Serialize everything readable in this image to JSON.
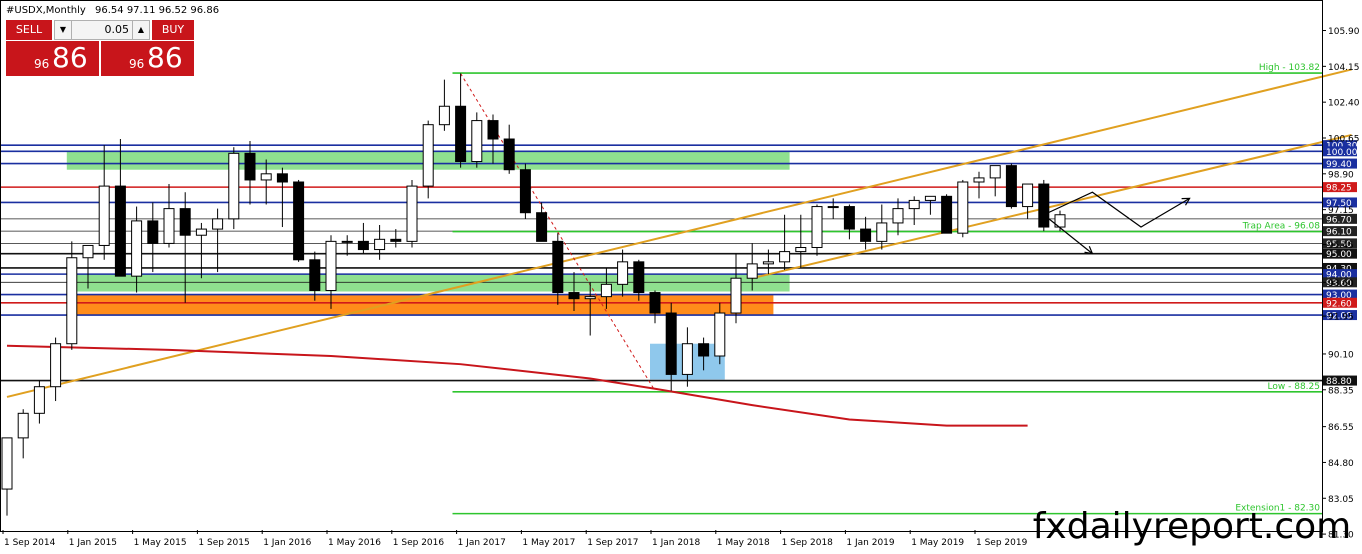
{
  "window": {
    "symbol": "#USDX,Monthly",
    "ohlc": "96.54 97.11 96.52 96.86"
  },
  "trade_panel": {
    "sell_label": "SELL",
    "buy_label": "BUY",
    "lot_value": "0.05",
    "sell_price_small": "96",
    "sell_price_big": "86",
    "buy_price_small": "96",
    "buy_price_big": "86"
  },
  "watermark": "fxdailyreport.com",
  "chart_data": {
    "type": "candlestick",
    "timeframe": "Monthly",
    "y_range": [
      81.5,
      107.0
    ],
    "y_ticks": [
      "105.90",
      "104.15",
      "102.40",
      "100.65",
      "98.90",
      "97.15",
      "95.45",
      "93.60",
      "91.95",
      "90.10",
      "88.35",
      "86.55",
      "84.80",
      "83.05",
      "81.30"
    ],
    "x_ticks": [
      "1 Sep 2014",
      "1 Jan 2015",
      "1 May 2015",
      "1 Sep 2015",
      "1 Jan 2016",
      "1 May 2016",
      "1 Sep 2016",
      "1 Jan 2017",
      "1 May 2017",
      "1 Sep 2017",
      "1 Jan 2018",
      "1 May 2018",
      "1 Sep 2018",
      "1 Jan 2019",
      "1 May 2019",
      "1 Sep 2019"
    ],
    "x_tick_index": [
      0,
      4,
      8,
      12,
      16,
      20,
      24,
      28,
      32,
      36,
      40,
      44,
      48,
      52,
      56,
      60
    ],
    "candles": [
      {
        "o": 83.5,
        "h": 86.0,
        "l": 82.2,
        "c": 86.0
      },
      {
        "o": 86.0,
        "h": 87.4,
        "l": 85.0,
        "c": 87.2
      },
      {
        "o": 87.2,
        "h": 88.8,
        "l": 86.7,
        "c": 88.5
      },
      {
        "o": 88.5,
        "h": 90.9,
        "l": 87.8,
        "c": 90.6
      },
      {
        "o": 90.6,
        "h": 95.6,
        "l": 90.3,
        "c": 94.8
      },
      {
        "o": 94.8,
        "h": 95.0,
        "l": 93.3,
        "c": 95.4
      },
      {
        "o": 95.4,
        "h": 100.3,
        "l": 94.7,
        "c": 98.3
      },
      {
        "o": 98.3,
        "h": 100.6,
        "l": 94.9,
        "c": 93.9
      },
      {
        "o": 93.9,
        "h": 97.3,
        "l": 93.1,
        "c": 96.6
      },
      {
        "o": 96.6,
        "h": 97.5,
        "l": 94.1,
        "c": 95.5
      },
      {
        "o": 95.5,
        "h": 98.4,
        "l": 95.3,
        "c": 97.2
      },
      {
        "o": 97.2,
        "h": 98.0,
        "l": 92.6,
        "c": 95.9
      },
      {
        "o": 95.9,
        "h": 96.5,
        "l": 93.8,
        "c": 96.2
      },
      {
        "o": 96.2,
        "h": 97.2,
        "l": 94.1,
        "c": 96.7
      },
      {
        "o": 96.7,
        "h": 100.2,
        "l": 96.2,
        "c": 99.9
      },
      {
        "o": 99.9,
        "h": 100.5,
        "l": 97.4,
        "c": 98.6
      },
      {
        "o": 98.6,
        "h": 99.6,
        "l": 97.4,
        "c": 98.9
      },
      {
        "o": 98.9,
        "h": 99.2,
        "l": 96.3,
        "c": 98.5
      },
      {
        "o": 98.5,
        "h": 98.6,
        "l": 94.6,
        "c": 94.7
      },
      {
        "o": 94.7,
        "h": 95.1,
        "l": 92.7,
        "c": 93.2
      },
      {
        "o": 93.2,
        "h": 95.9,
        "l": 92.3,
        "c": 95.6
      },
      {
        "o": 95.6,
        "h": 95.9,
        "l": 94.9,
        "c": 95.6
      },
      {
        "o": 95.6,
        "h": 96.5,
        "l": 95.0,
        "c": 95.2
      },
      {
        "o": 95.2,
        "h": 96.4,
        "l": 94.7,
        "c": 95.7
      },
      {
        "o": 95.7,
        "h": 96.2,
        "l": 95.3,
        "c": 95.6
      },
      {
        "o": 95.6,
        "h": 98.6,
        "l": 95.3,
        "c": 98.3
      },
      {
        "o": 98.3,
        "h": 101.5,
        "l": 97.7,
        "c": 101.3
      },
      {
        "o": 101.3,
        "h": 103.5,
        "l": 101.0,
        "c": 102.2
      },
      {
        "o": 102.2,
        "h": 103.8,
        "l": 99.2,
        "c": 99.5
      },
      {
        "o": 99.5,
        "h": 101.9,
        "l": 99.2,
        "c": 101.5
      },
      {
        "o": 101.5,
        "h": 101.8,
        "l": 99.4,
        "c": 100.6
      },
      {
        "o": 100.6,
        "h": 101.3,
        "l": 98.9,
        "c": 99.1
      },
      {
        "o": 99.1,
        "h": 99.4,
        "l": 96.7,
        "c": 97.0
      },
      {
        "o": 97.0,
        "h": 97.5,
        "l": 95.7,
        "c": 95.6
      },
      {
        "o": 95.6,
        "h": 96.0,
        "l": 92.5,
        "c": 93.1
      },
      {
        "o": 93.1,
        "h": 94.1,
        "l": 92.2,
        "c": 92.8
      },
      {
        "o": 92.8,
        "h": 93.6,
        "l": 91.0,
        "c": 92.9
      },
      {
        "o": 92.9,
        "h": 94.3,
        "l": 92.3,
        "c": 93.5
      },
      {
        "o": 93.5,
        "h": 95.2,
        "l": 92.9,
        "c": 94.6
      },
      {
        "o": 94.6,
        "h": 94.7,
        "l": 92.7,
        "c": 93.1
      },
      {
        "o": 93.1,
        "h": 93.2,
        "l": 91.6,
        "c": 92.1
      },
      {
        "o": 92.1,
        "h": 92.6,
        "l": 88.3,
        "c": 89.1
      },
      {
        "o": 89.1,
        "h": 91.4,
        "l": 88.5,
        "c": 90.6
      },
      {
        "o": 90.6,
        "h": 90.9,
        "l": 89.3,
        "c": 90.0
      },
      {
        "o": 90.0,
        "h": 92.6,
        "l": 89.6,
        "c": 92.1
      },
      {
        "o": 92.1,
        "h": 95.0,
        "l": 91.6,
        "c": 93.8
      },
      {
        "o": 93.8,
        "h": 95.5,
        "l": 93.2,
        "c": 94.5
      },
      {
        "o": 94.5,
        "h": 95.2,
        "l": 94.0,
        "c": 94.6
      },
      {
        "o": 94.6,
        "h": 96.9,
        "l": 94.2,
        "c": 95.1
      },
      {
        "o": 95.1,
        "h": 96.9,
        "l": 94.3,
        "c": 95.3
      },
      {
        "o": 95.3,
        "h": 97.4,
        "l": 94.9,
        "c": 97.3
      },
      {
        "o": 97.3,
        "h": 97.7,
        "l": 96.7,
        "c": 97.3
      },
      {
        "o": 97.3,
        "h": 97.4,
        "l": 95.7,
        "c": 96.2
      },
      {
        "o": 96.2,
        "h": 96.8,
        "l": 95.2,
        "c": 95.6
      },
      {
        "o": 95.6,
        "h": 97.4,
        "l": 95.2,
        "c": 96.5
      },
      {
        "o": 96.5,
        "h": 97.7,
        "l": 95.9,
        "c": 97.2
      },
      {
        "o": 97.2,
        "h": 97.8,
        "l": 96.4,
        "c": 97.6
      },
      {
        "o": 97.6,
        "h": 97.8,
        "l": 96.9,
        "c": 97.8
      },
      {
        "o": 97.8,
        "h": 97.9,
        "l": 96.9,
        "c": 96.0
      },
      {
        "o": 96.0,
        "h": 98.6,
        "l": 95.8,
        "c": 98.5
      },
      {
        "o": 98.5,
        "h": 99.0,
        "l": 97.7,
        "c": 98.7
      },
      {
        "o": 98.7,
        "h": 99.3,
        "l": 97.8,
        "c": 99.3
      },
      {
        "o": 99.3,
        "h": 99.4,
        "l": 97.2,
        "c": 97.3
      },
      {
        "o": 97.3,
        "h": 98.4,
        "l": 96.7,
        "c": 98.4
      },
      {
        "o": 98.4,
        "h": 98.6,
        "l": 96.1,
        "c": 96.3
      },
      {
        "o": 96.3,
        "h": 97.1,
        "l": 96.1,
        "c": 96.9
      }
    ],
    "moving_average": [
      {
        "i": 0,
        "v": 90.5
      },
      {
        "i": 10,
        "v": 90.3
      },
      {
        "i": 20,
        "v": 90.0
      },
      {
        "i": 28,
        "v": 89.6
      },
      {
        "i": 36,
        "v": 88.9
      },
      {
        "i": 40,
        "v": 88.4
      },
      {
        "i": 46,
        "v": 87.6
      },
      {
        "i": 52,
        "v": 86.9
      },
      {
        "i": 58,
        "v": 86.6
      },
      {
        "i": 63,
        "v": 86.6
      }
    ],
    "trendlines": [
      {
        "from": {
          "i": 0,
          "v": 88.0
        },
        "to": {
          "i": 83,
          "v": 104.0
        },
        "color": "#e0a020"
      },
      {
        "from": {
          "i": 46,
          "v": 93.8
        },
        "to": {
          "i": 83,
          "v": 100.8
        },
        "color": "#e0a020"
      }
    ],
    "horizontal_lines": [
      {
        "v": 100.3,
        "color": "#1a2fa0",
        "label": "100.30"
      },
      {
        "v": 100.0,
        "color": "#1a2fa0",
        "label": "100.00"
      },
      {
        "v": 99.4,
        "color": "#1a2fa0",
        "label": "99.40"
      },
      {
        "v": 98.25,
        "color": "#d01a1a",
        "label": "98.25"
      },
      {
        "v": 97.5,
        "color": "#1a2fa0",
        "label": "97.50"
      },
      {
        "v": 96.7,
        "color": "#222222",
        "label": "96.70"
      },
      {
        "v": 96.1,
        "color": "#222222",
        "label": "96.10"
      },
      {
        "v": 95.5,
        "color": "#222222",
        "label": "95.50"
      },
      {
        "v": 95.0,
        "color": "#111111",
        "label": "95.00"
      },
      {
        "v": 94.3,
        "color": "#111111",
        "label": "94.30"
      },
      {
        "v": 94.0,
        "color": "#1a2fa0",
        "label": "94.00"
      },
      {
        "v": 93.6,
        "color": "#222222",
        "label": "93.60"
      },
      {
        "v": 93.0,
        "color": "#1a2fa0",
        "label": "93.00"
      },
      {
        "v": 92.6,
        "color": "#d01a1a",
        "label": "92.60"
      },
      {
        "v": 92.0,
        "color": "#1a2fa0",
        "label": "92.00"
      },
      {
        "v": 88.8,
        "color": "#111111",
        "label": "88.80"
      }
    ],
    "fib_lines": [
      {
        "v": 103.82,
        "label": "High - 103.82"
      },
      {
        "v": 96.08,
        "label": "Trap Area - 96.08"
      },
      {
        "v": 88.25,
        "label": "Low - 88.25"
      },
      {
        "v": 82.3,
        "label": "Extension1 - 82.30"
      }
    ],
    "zones": [
      {
        "v_top": 100.0,
        "v_bottom": 99.1,
        "i_from": 4,
        "i_to": 48,
        "color": "#8fe08f"
      },
      {
        "v_top": 94.0,
        "v_bottom": 93.15,
        "i_from": 4,
        "i_to": 48,
        "color": "#8fe08f"
      },
      {
        "v_top": 93.0,
        "v_bottom": 92.0,
        "i_from": 4,
        "i_to": 47,
        "color": "#ff8c1a"
      },
      {
        "v_top": 90.6,
        "v_bottom": 88.85,
        "i_from": 40,
        "i_to": 44,
        "color": "#8fc8ec"
      }
    ],
    "arrows_up": [
      [
        64,
        96.9
      ],
      [
        67,
        98.0
      ],
      [
        70,
        96.3
      ],
      [
        73,
        97.7
      ]
    ],
    "arrows_down": [
      [
        64,
        96.9
      ],
      [
        67,
        95.0
      ]
    ],
    "dashed_diagonal": {
      "from": {
        "i": 28,
        "v": 103.8
      },
      "to": {
        "i": 40,
        "v": 88.3
      }
    }
  }
}
